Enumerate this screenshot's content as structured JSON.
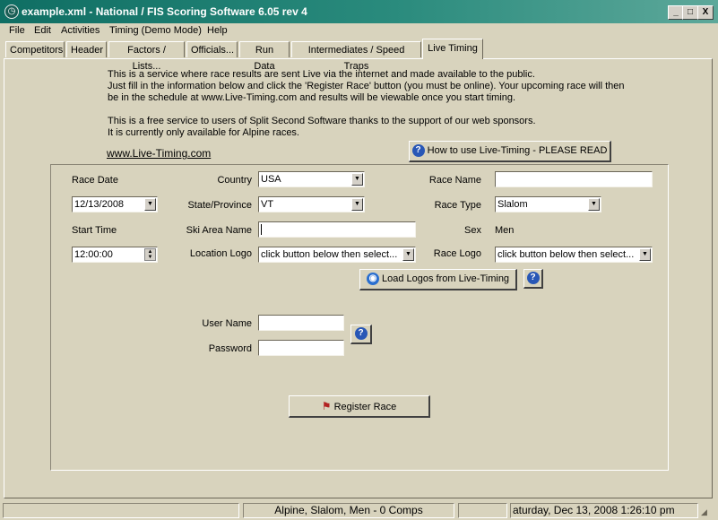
{
  "window": {
    "title": "example.xml - National / FIS Scoring Software 6.05 rev 4",
    "controls": {
      "minimize": "_",
      "maximize": "□",
      "close": "X"
    }
  },
  "menu": [
    "File",
    "Edit",
    "Activities",
    "Timing (Demo Mode)",
    "Help"
  ],
  "tabs": [
    "Competitors",
    "Header",
    "Factors / Lists...",
    "Officials...",
    "Run Data",
    "Intermediates / Speed Traps",
    "Live Timing"
  ],
  "active_tab": "Live Timing",
  "info": {
    "line1": "This is a service where race results are sent Live via the internet and made available to the public.",
    "line2": "Just fill in the information below and click the 'Register Race' button (you must be online). Your upcoming race will then",
    "line3": "be in the schedule at www.Live-Timing.com and results will be viewable once you start timing.",
    "line4": "This is a free service to users of Split Second Software thanks to the support of our web sponsors.",
    "line5": "It is currently only available for Alpine races."
  },
  "link": "www.Live-Timing.com",
  "how_to_button": "How to use Live-Timing - PLEASE READ",
  "form": {
    "race_date_label": "Race Date",
    "race_date_value": "12/13/2008",
    "start_time_label": "Start Time",
    "start_time_value": "12:00:00",
    "country_label": "Country",
    "country_value": "USA",
    "state_label": "State/Province",
    "state_value": "VT",
    "ski_area_label": "Ski Area Name",
    "ski_area_value": "",
    "location_logo_label": "Location Logo",
    "location_logo_value": "click button below then select...",
    "race_name_label": "Race Name",
    "race_name_value": "",
    "race_type_label": "Race Type",
    "race_type_value": "Slalom",
    "sex_label": "Sex",
    "sex_value": "Men",
    "race_logo_label": "Race Logo",
    "race_logo_value": "click button below then select...",
    "load_logos_button": "Load Logos from Live-Timing",
    "username_label": "User Name",
    "username_value": "",
    "password_label": "Password",
    "password_value": "",
    "register_button": "Register Race"
  },
  "status": {
    "race_summary": "Alpine, Slalom, Men - 0 Comps",
    "datetime": "aturday, Dec 13, 2008  1:26:10 pm"
  }
}
